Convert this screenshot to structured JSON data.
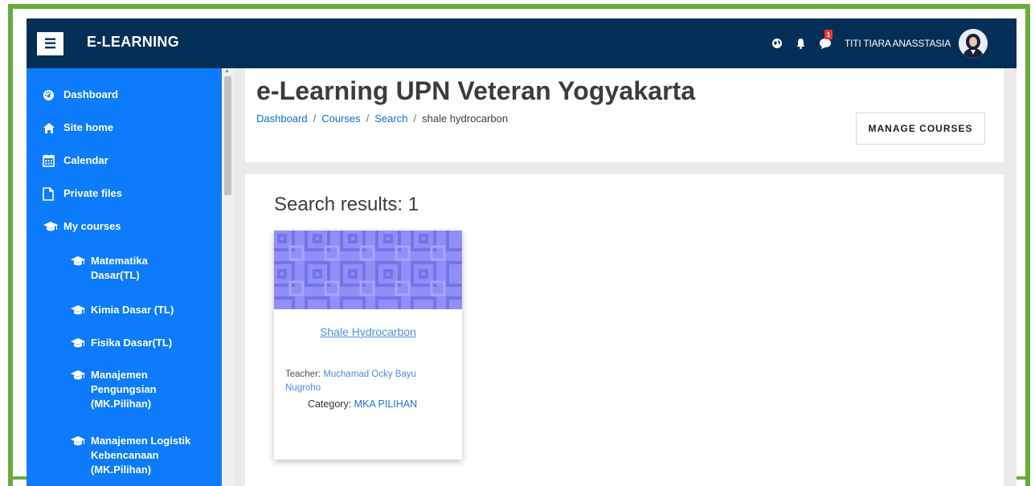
{
  "app": {
    "brand": "E-LEARNING",
    "menu_icon": "☰"
  },
  "navbar": {
    "username": "TITI TIARA ANASSTASIA",
    "message_badge": "1",
    "icons": [
      "language-icon",
      "notification-bell-icon",
      "messages-icon",
      "user-avatar"
    ]
  },
  "sidebar": {
    "items": [
      {
        "label": "Dashboard",
        "icon": "dashboard-icon"
      },
      {
        "label": "Site home",
        "icon": "home-icon"
      },
      {
        "label": "Calendar",
        "icon": "calendar-icon"
      },
      {
        "label": "Private files",
        "icon": "file-icon"
      },
      {
        "label": "My courses",
        "icon": "graduation-cap-icon"
      }
    ],
    "courses": [
      {
        "label": "Matematika Dasar(TL)"
      },
      {
        "label": "Kimia Dasar (TL)"
      },
      {
        "label": "Fisika Dasar(TL)"
      },
      {
        "label": "Manajemen Pengungsian (MK.Pilihan)"
      },
      {
        "label": "Manajemen Logistik Kebencanaan (MK.Pilihan)"
      }
    ]
  },
  "header": {
    "title": "e-Learning UPN Veteran Yogyakarta",
    "breadcrumb": [
      "Dashboard",
      "Courses",
      "Search",
      "shale hydrocarbon"
    ],
    "manage_button": "MANAGE COURSES"
  },
  "results": {
    "title": "Search results: 1",
    "course": {
      "name": "Shale Hydrocarbon",
      "teacher_label": "Teacher: ",
      "teacher_name": "Muchamad Ocky Bayu Nugroho",
      "category_label": "Category: ",
      "category_name": "MKA PILIHAN"
    }
  },
  "colors": {
    "navbar": "#032f57",
    "sidebar": "#0c7cfc",
    "link": "#0a6fd0",
    "frame": "#6aaa3a"
  }
}
